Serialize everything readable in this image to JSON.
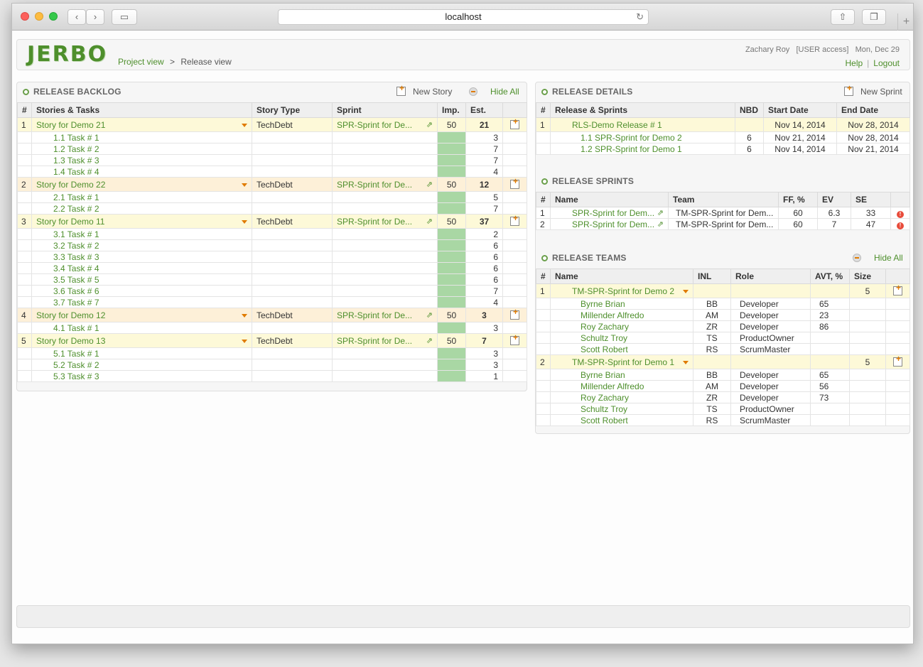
{
  "browser": {
    "url": "localhost"
  },
  "header": {
    "logo": "JERBO",
    "breadcrumb": [
      "Project view",
      ">",
      "Release view"
    ],
    "user": "Zachary Roy",
    "access": "[USER access]",
    "date": "Mon, Dec 29",
    "help": "Help",
    "sep": "|",
    "logout": "Logout"
  },
  "backlog": {
    "title": "RELEASE BACKLOG",
    "new_story": "New Story",
    "hide_all": "Hide All",
    "columns": [
      "#",
      "Stories & Tasks",
      "Story Type",
      "Sprint",
      "Imp.",
      "Est."
    ],
    "rows": [
      {
        "kind": "story",
        "idx": "1",
        "name": "Story for Demo 21",
        "type": "TechDebt",
        "sprint": "SPR-Sprint for De...",
        "imp": "50",
        "est": "21"
      },
      {
        "kind": "task",
        "name": "1.1 Task # 1",
        "est": "3"
      },
      {
        "kind": "task",
        "name": "1.2 Task # 2",
        "est": "7"
      },
      {
        "kind": "task",
        "name": "1.3 Task # 3",
        "est": "7"
      },
      {
        "kind": "task",
        "name": "1.4 Task # 4",
        "est": "4"
      },
      {
        "kind": "story",
        "idx": "2",
        "name": "Story for Demo 22",
        "type": "TechDebt",
        "sprint": "SPR-Sprint for De...",
        "imp": "50",
        "est": "12"
      },
      {
        "kind": "task",
        "name": "2.1 Task # 1",
        "est": "5"
      },
      {
        "kind": "task",
        "name": "2.2 Task # 2",
        "est": "7"
      },
      {
        "kind": "story",
        "idx": "3",
        "name": "Story for Demo 11",
        "type": "TechDebt",
        "sprint": "SPR-Sprint for De...",
        "imp": "50",
        "est": "37"
      },
      {
        "kind": "task",
        "name": "3.1 Task # 1",
        "est": "2"
      },
      {
        "kind": "task",
        "name": "3.2 Task # 2",
        "est": "6"
      },
      {
        "kind": "task",
        "name": "3.3 Task # 3",
        "est": "6"
      },
      {
        "kind": "task",
        "name": "3.4 Task # 4",
        "est": "6"
      },
      {
        "kind": "task",
        "name": "3.5 Task # 5",
        "est": "6"
      },
      {
        "kind": "task",
        "name": "3.6 Task # 6",
        "est": "7"
      },
      {
        "kind": "task",
        "name": "3.7 Task # 7",
        "est": "4"
      },
      {
        "kind": "story",
        "idx": "4",
        "name": "Story for Demo 12",
        "type": "TechDebt",
        "sprint": "SPR-Sprint for De...",
        "imp": "50",
        "est": "3"
      },
      {
        "kind": "task",
        "name": "4.1 Task # 1",
        "est": "3"
      },
      {
        "kind": "story",
        "idx": "5",
        "name": "Story for Demo 13",
        "type": "TechDebt",
        "sprint": "SPR-Sprint for De...",
        "imp": "50",
        "est": "7"
      },
      {
        "kind": "task",
        "name": "5.1 Task # 1",
        "est": "3"
      },
      {
        "kind": "task",
        "name": "5.2 Task # 2",
        "est": "3"
      },
      {
        "kind": "task",
        "name": "5.3 Task # 3",
        "est": "1"
      }
    ]
  },
  "details": {
    "title": "RELEASE DETAILS",
    "new_sprint": "New Sprint",
    "columns": [
      "#",
      "Release & Sprints",
      "NBD",
      "Start Date",
      "End Date"
    ],
    "rows": [
      {
        "idx": "1",
        "name": "RLS-Demo Release # 1",
        "nbd": "",
        "start": "Nov 14, 2014",
        "end": "Nov 28, 2014",
        "kind": "release"
      },
      {
        "idx": "",
        "name": "1.1  SPR-Sprint for Demo 2",
        "nbd": "6",
        "start": "Nov 21, 2014",
        "end": "Nov 28, 2014",
        "kind": "sprint"
      },
      {
        "idx": "",
        "name": "1.2  SPR-Sprint for Demo 1",
        "nbd": "6",
        "start": "Nov 14, 2014",
        "end": "Nov 21, 2014",
        "kind": "sprint"
      }
    ]
  },
  "sprints": {
    "title": "RELEASE SPRINTS",
    "columns": [
      "#",
      "Name",
      "Team",
      "FF, %",
      "EV",
      "SE",
      ""
    ],
    "rows": [
      {
        "idx": "1",
        "name": "SPR-Sprint for Dem...",
        "team": "TM-SPR-Sprint for Dem...",
        "ff": "60",
        "ev": "6.3",
        "se": "33",
        "warn": "!"
      },
      {
        "idx": "2",
        "name": "SPR-Sprint for Dem...",
        "team": "TM-SPR-Sprint for Dem...",
        "ff": "60",
        "ev": "7",
        "se": "47",
        "warn": "!"
      }
    ]
  },
  "teams": {
    "title": "RELEASE TEAMS",
    "hide_all": "Hide All",
    "columns": [
      "#",
      "Name",
      "INL",
      "Role",
      "AVT, %",
      "Size",
      ""
    ],
    "rows": [
      {
        "kind": "team",
        "idx": "1",
        "name": "TM-SPR-Sprint for Demo 2",
        "size": "5"
      },
      {
        "kind": "member",
        "name": "Byrne Brian",
        "inl": "BB",
        "role": "Developer",
        "avt": "65"
      },
      {
        "kind": "member",
        "name": "Millender Alfredo",
        "inl": "AM",
        "role": "Developer",
        "avt": "23"
      },
      {
        "kind": "member",
        "name": "Roy Zachary",
        "inl": "ZR",
        "role": "Developer",
        "avt": "86"
      },
      {
        "kind": "member",
        "name": "Schultz Troy",
        "inl": "TS",
        "role": "ProductOwner",
        "avt": ""
      },
      {
        "kind": "member",
        "name": "Scott Robert",
        "inl": "RS",
        "role": "ScrumMaster",
        "avt": ""
      },
      {
        "kind": "team",
        "idx": "2",
        "name": "TM-SPR-Sprint for Demo 1",
        "size": "5"
      },
      {
        "kind": "member",
        "name": "Byrne Brian",
        "inl": "BB",
        "role": "Developer",
        "avt": "65"
      },
      {
        "kind": "member",
        "name": "Millender Alfredo",
        "inl": "AM",
        "role": "Developer",
        "avt": "56"
      },
      {
        "kind": "member",
        "name": "Roy Zachary",
        "inl": "ZR",
        "role": "Developer",
        "avt": "73"
      },
      {
        "kind": "member",
        "name": "Schultz Troy",
        "inl": "TS",
        "role": "ProductOwner",
        "avt": ""
      },
      {
        "kind": "member",
        "name": "Scott Robert",
        "inl": "RS",
        "role": "ScrumMaster",
        "avt": ""
      }
    ]
  }
}
